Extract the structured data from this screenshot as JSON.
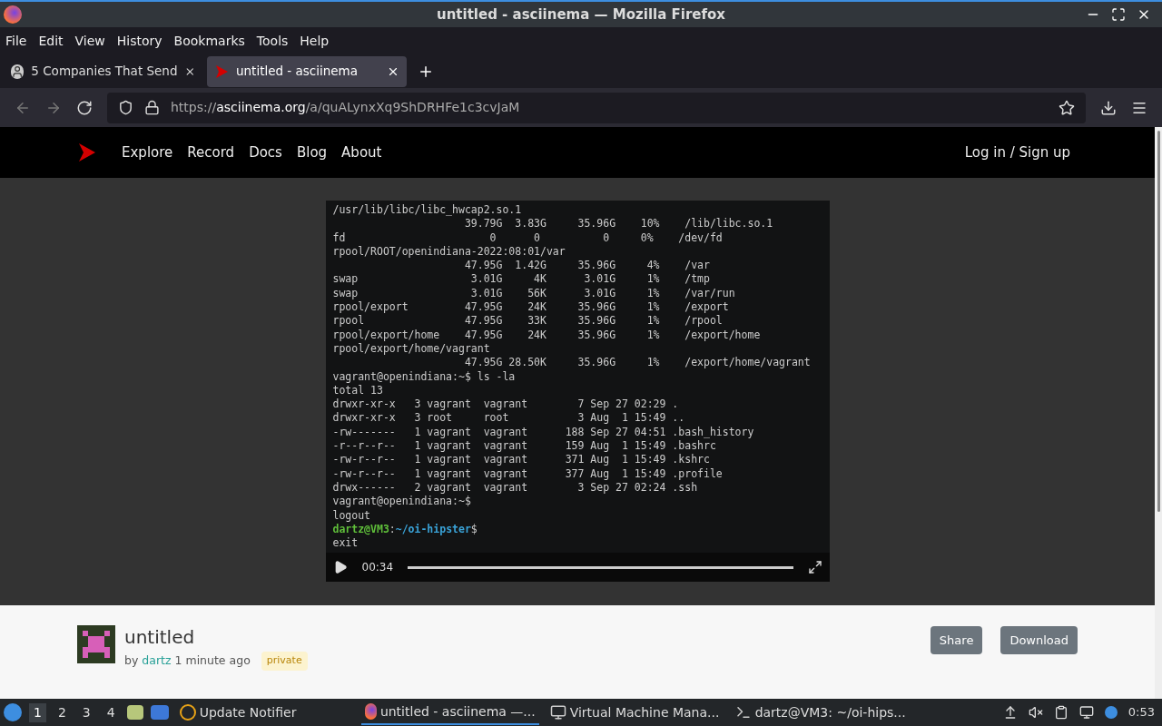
{
  "window": {
    "title": "untitled - asciinema — Mozilla Firefox"
  },
  "menu": [
    "File",
    "Edit",
    "View",
    "History",
    "Bookmarks",
    "Tools",
    "Help"
  ],
  "tabs": [
    {
      "label": "5 Companies That Send",
      "selected": false,
      "kind": "person"
    },
    {
      "label": "untitled - asciinema",
      "selected": true,
      "kind": "site"
    }
  ],
  "address_bar": {
    "scheme": "https://",
    "host": "asciinema.org",
    "path": "/a/quALynxXq9ShDRHFe1c3cvJaM"
  },
  "site_nav": {
    "links": [
      "Explore",
      "Record",
      "Docs",
      "Blog",
      "About"
    ],
    "account": "Log in / Sign up"
  },
  "terminal": {
    "lines": [
      [
        {
          "text": "/usr/lib/libc/libc_hwcap2.so.1",
          "kind": "plain"
        }
      ],
      [
        {
          "text": "                     39.79G  3.83G     35.96G    10%    /lib/libc.so.1",
          "kind": "plain"
        }
      ],
      [
        {
          "text": "fd                       0      0          0     0%    /dev/fd",
          "kind": "plain"
        }
      ],
      [
        {
          "text": "rpool/ROOT/openindiana-2022:08:01/var",
          "kind": "plain"
        }
      ],
      [
        {
          "text": "                     47.95G  1.42G     35.96G     4%    /var",
          "kind": "plain"
        }
      ],
      [
        {
          "text": "swap                  3.01G     4K      3.01G     1%    /tmp",
          "kind": "plain"
        }
      ],
      [
        {
          "text": "swap                  3.01G    56K      3.01G     1%    /var/run",
          "kind": "plain"
        }
      ],
      [
        {
          "text": "rpool/export         47.95G    24K     35.96G     1%    /export",
          "kind": "plain"
        }
      ],
      [
        {
          "text": "rpool                47.95G    33K     35.96G     1%    /rpool",
          "kind": "plain"
        }
      ],
      [
        {
          "text": "rpool/export/home    47.95G    24K     35.96G     1%    /export/home",
          "kind": "plain"
        }
      ],
      [
        {
          "text": "rpool/export/home/vagrant",
          "kind": "plain"
        }
      ],
      [
        {
          "text": "                     47.95G 28.50K     35.96G     1%    /export/home/vagrant",
          "kind": "plain"
        }
      ],
      [
        {
          "text": "vagrant@openindiana:~$ ls -la",
          "kind": "plain"
        }
      ],
      [
        {
          "text": "total 13",
          "kind": "plain"
        }
      ],
      [
        {
          "text": "drwxr-xr-x   3 vagrant  vagrant        7 Sep 27 02:29 .",
          "kind": "plain"
        }
      ],
      [
        {
          "text": "drwxr-xr-x   3 root     root           3 Aug  1 15:49 ..",
          "kind": "plain"
        }
      ],
      [
        {
          "text": "-rw-------   1 vagrant  vagrant      188 Sep 27 04:51 .bash_history",
          "kind": "plain"
        }
      ],
      [
        {
          "text": "-r--r--r--   1 vagrant  vagrant      159 Aug  1 15:49 .bashrc",
          "kind": "plain"
        }
      ],
      [
        {
          "text": "-rw-r--r--   1 vagrant  vagrant      371 Aug  1 15:49 .kshrc",
          "kind": "plain"
        }
      ],
      [
        {
          "text": "-rw-r--r--   1 vagrant  vagrant      377 Aug  1 15:49 .profile",
          "kind": "plain"
        }
      ],
      [
        {
          "text": "drwx------   2 vagrant  vagrant        3 Sep 27 02:24 .ssh",
          "kind": "plain"
        }
      ],
      [
        {
          "text": "vagrant@openindiana:~$",
          "kind": "plain"
        }
      ],
      [
        {
          "text": "logout",
          "kind": "plain"
        }
      ],
      [
        {
          "text": "dartz@VM3",
          "kind": "user"
        },
        {
          "text": ":",
          "kind": "plain"
        },
        {
          "text": "~/oi-hipster",
          "kind": "path"
        },
        {
          "text": "$",
          "kind": "plain"
        }
      ],
      [
        {
          "text": "exit",
          "kind": "plain"
        }
      ]
    ],
    "time": "00:34",
    "progress": {
      "level": 1.0
    }
  },
  "recording": {
    "title": "untitled",
    "by": "by",
    "author": "dartz",
    "age": "1 minute ago",
    "badge": "private",
    "buttons": [
      "Share",
      "Download"
    ]
  },
  "taskbar": {
    "workspaces": [
      {
        "label": "1",
        "selected": true
      },
      {
        "label": "2",
        "selected": false
      },
      {
        "label": "3",
        "selected": false
      },
      {
        "label": "4",
        "selected": false
      }
    ],
    "tasks": [
      {
        "label": "Update Notifier",
        "selected": false,
        "kind": "notifier"
      },
      {
        "label": "untitled - asciinema —...",
        "selected": true,
        "kind": "browser"
      },
      {
        "label": "Virtual Machine Mana...",
        "selected": false,
        "kind": "vm"
      },
      {
        "label": "dartz@VM3: ~/oi-hips...",
        "selected": false,
        "kind": "terminal"
      }
    ],
    "clock": "0:53"
  }
}
